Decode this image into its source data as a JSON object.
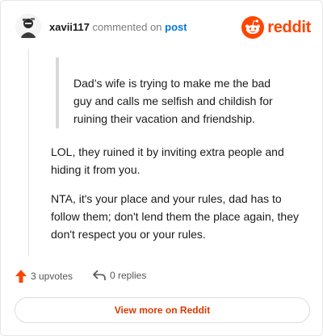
{
  "header": {
    "username": "xavii117",
    "action_text": "commented on",
    "post_link": "post",
    "brand": "reddit",
    "brand_color": "#ff4500"
  },
  "comment": {
    "quote": "Dad’s wife is trying to make me the bad guy and calls me selfish and childish for ruining their vacation and friendship.",
    "paragraphs": [
      "LOL, they ruined it by inviting extra people and hiding it from you.",
      "NTA, it's your place and your rules, dad has to follow them; don't lend them the place again, they don't respect you or your rules."
    ]
  },
  "footer": {
    "upvotes": "3 upvotes",
    "replies": "0 replies",
    "upvote_icon": "upvote-arrow-icon",
    "reply_icon": "reply-arrow-icon"
  },
  "cta": {
    "label": "View more on Reddit",
    "color": "#d93a00"
  }
}
